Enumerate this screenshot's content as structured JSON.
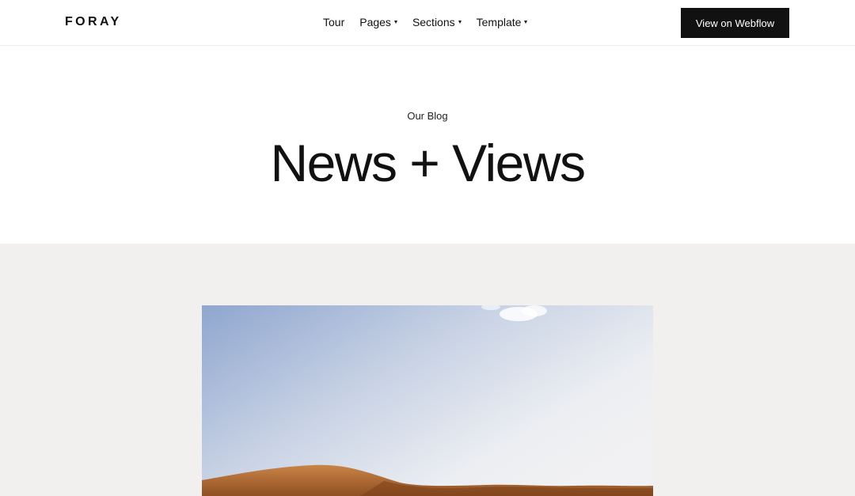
{
  "brand": {
    "logo_text": "FORAY"
  },
  "nav": {
    "items": [
      {
        "label": "Tour",
        "has_dropdown": false
      },
      {
        "label": "Pages",
        "has_dropdown": true
      },
      {
        "label": "Sections",
        "has_dropdown": true
      },
      {
        "label": "Template",
        "has_dropdown": true
      }
    ],
    "cta_label": "View on Webflow"
  },
  "hero": {
    "eyebrow": "Our Blog",
    "title": "News + Views"
  },
  "colors": {
    "accent": "#111111",
    "featured_bg": "#f1f0ee",
    "sky_top": "#8fa6cf",
    "dune": "#b8723c"
  }
}
